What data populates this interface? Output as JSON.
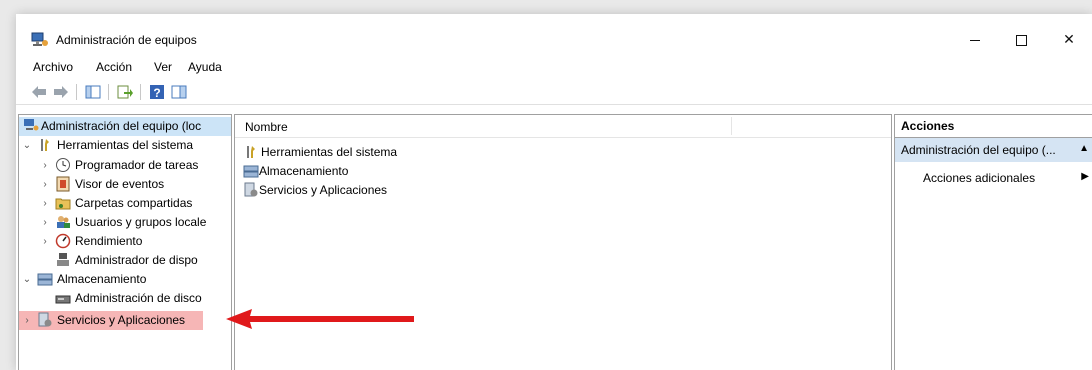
{
  "window": {
    "title": "Administración de equipos",
    "controls": {
      "minimize": "–",
      "maximize": "□",
      "close": "✕"
    }
  },
  "menu": [
    "Archivo",
    "Acción",
    "Ver",
    "Ayuda"
  ],
  "toolbar": {
    "buttons": [
      "back-icon",
      "forward-icon",
      "show-hide-tree-icon",
      "export-list-icon",
      "help-icon",
      "show-hide-action-pane-icon"
    ]
  },
  "tree": {
    "root": "Administración del equipo (loc",
    "system_tools": "Herramientas del sistema",
    "task_scheduler": "Programador de tareas",
    "event_viewer": "Visor de eventos",
    "shared_folders": "Carpetas compartidas",
    "local_users": "Usuarios y grupos locale",
    "performance": "Rendimiento",
    "device_manager": "Administrador de dispo",
    "storage": "Almacenamiento",
    "disk_management": "Administración de disco",
    "services_apps": "Servicios y Aplicaciones"
  },
  "list": {
    "column_name": "Nombre",
    "items": [
      "Herramientas del sistema",
      "Almacenamiento",
      "Servicios y Aplicaciones"
    ]
  },
  "actions": {
    "header": "Acciones",
    "section": "Administración del equipo (...",
    "more_actions": "Acciones adicionales"
  },
  "colors": {
    "selection": "#cce4f7",
    "highlight": "#f6b6b6",
    "arrow": "#e0191b",
    "actions_section": "#d5e4f3"
  }
}
